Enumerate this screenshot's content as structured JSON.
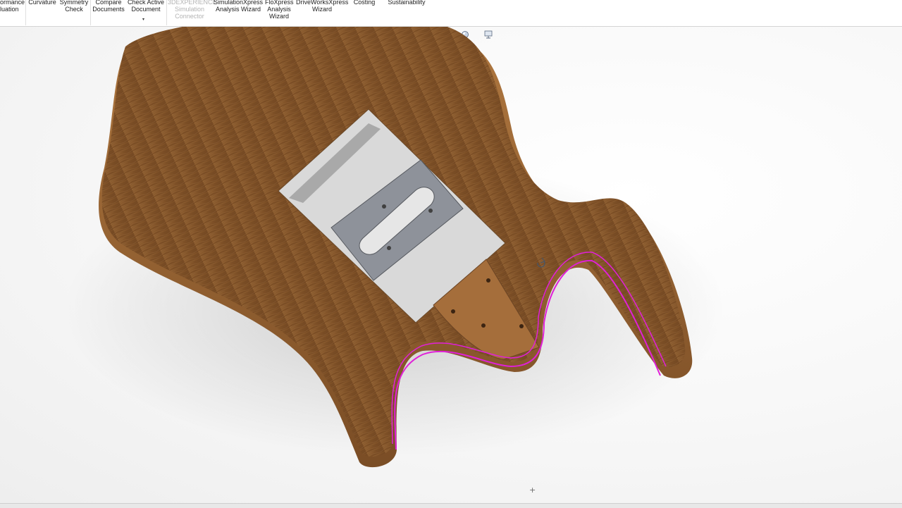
{
  "ribbon": {
    "items": [
      {
        "label": "ormance\nluation",
        "disabled": false
      },
      {
        "label": "Curvature",
        "disabled": false
      },
      {
        "label": "Symmetry\nCheck",
        "disabled": false
      },
      {
        "label": "Compare\nDocuments",
        "disabled": false
      },
      {
        "label": "Check Active\nDocument",
        "disabled": false
      },
      {
        "label": "3DEXPERIENCE\nSimulation\nConnector",
        "disabled": true
      },
      {
        "label": "SimulationXpress\nAnalysis Wizard",
        "disabled": false
      },
      {
        "label": "FloXpress\nAnalysis\nWizard",
        "disabled": false
      },
      {
        "label": "DriveWorksXpress\nWizard",
        "disabled": false
      },
      {
        "label": "Costing",
        "disabled": false
      },
      {
        "label": "Sustainability",
        "disabled": false
      }
    ],
    "dropdown_arrow": "▾"
  },
  "heads_up_toolbar": {
    "icons": [
      "zoom-to-fit-icon",
      "zoom-to-area-icon",
      "previous-view-icon",
      "section-view-icon",
      "dynamic-annotation-icon",
      "view-orientation-icon",
      "display-style-icon",
      "hide-show-items-icon",
      "edit-appearance-icon",
      "apply-scene-icon",
      "view-settings-icon"
    ]
  },
  "viewport": {
    "origin_glyph": "+",
    "model": "guitar-body",
    "wood_color": "#8a5a2e",
    "edge_highlight_color": "#e020d8",
    "plate_color": "#8e929a"
  }
}
